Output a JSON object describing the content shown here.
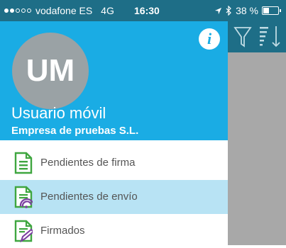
{
  "status_bar": {
    "carrier": "vodafone ES",
    "network": "4G",
    "time": "16:30",
    "battery_text": "38 %",
    "battery_level": 0.38,
    "signal_bars_filled": 2,
    "signal_bars_total": 5
  },
  "header": {
    "avatar_initials": "UM",
    "user_name": "Usuario móvil",
    "company": "Empresa de pruebas S.L."
  },
  "menu": {
    "items": [
      {
        "label": "Pendientes de firma",
        "icon": "document-lines-icon",
        "selected": false
      },
      {
        "label": "Pendientes de envío",
        "icon": "document-send-icon",
        "selected": true
      },
      {
        "label": "Firmados",
        "icon": "document-signed-icon",
        "selected": false
      }
    ]
  },
  "colors": {
    "header_bg": "#1aace4",
    "status_bar_bg": "#1e6e87",
    "selected_item_bg": "#b8e3f4",
    "icon_green": "#3fa640",
    "icon_purple": "#7a3ea0",
    "overlay_gray": "#a8a8a8"
  }
}
